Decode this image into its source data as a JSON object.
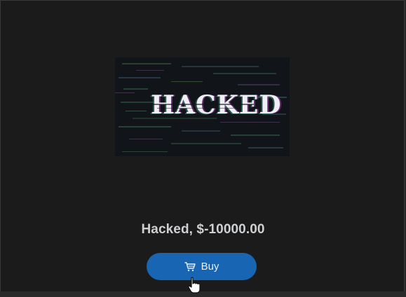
{
  "product": {
    "image_text": "HACKED",
    "title": "Hacked, $-10000.00",
    "buy_label": "Buy"
  },
  "icons": {
    "cart": "cart-icon",
    "cursor": "hand-pointer-icon"
  },
  "colors": {
    "card_background": "#1b1b1c",
    "button": "#1765b3",
    "title_text": "#cfd0d2"
  }
}
